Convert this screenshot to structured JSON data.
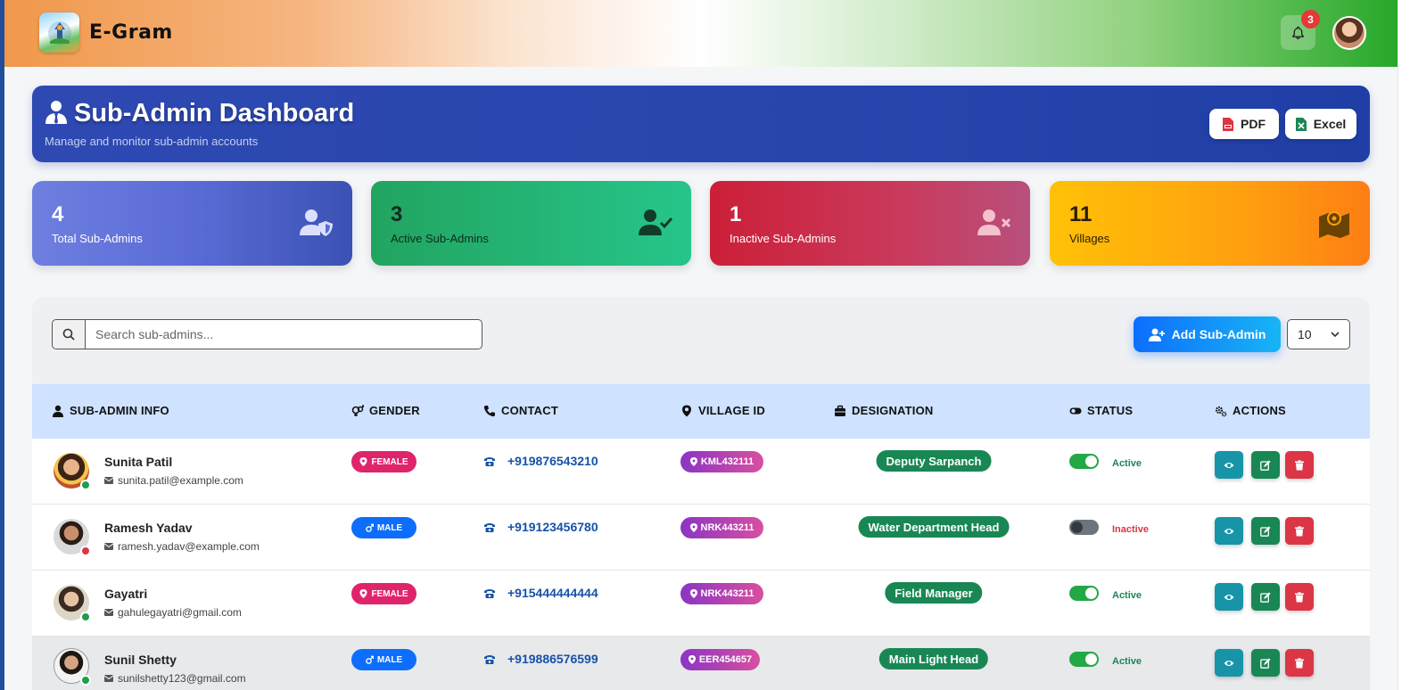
{
  "app": {
    "brand": "E-Gram",
    "notification_count": "3"
  },
  "header": {
    "title": "Sub-Admin Dashboard",
    "subtitle": "Manage and monitor sub-admin accounts",
    "pdf_label": "PDF",
    "excel_label": "Excel"
  },
  "stats": [
    {
      "value": "4",
      "label": "Total Sub-Admins",
      "icon": "user-shield-icon"
    },
    {
      "value": "3",
      "label": "Active Sub-Admins",
      "icon": "user-check-icon"
    },
    {
      "value": "1",
      "label": "Inactive Sub-Admins",
      "icon": "user-times-icon"
    },
    {
      "value": "11",
      "label": "Villages",
      "icon": "map-icon"
    }
  ],
  "toolbar": {
    "search_placeholder": "Search sub-admins...",
    "add_label": "Add Sub-Admin",
    "page_size": "10"
  },
  "table": {
    "columns": [
      "SUB-ADMIN INFO",
      "GENDER",
      "CONTACT",
      "VILLAGE ID",
      "DESIGNATION",
      "STATUS",
      "ACTIONS"
    ],
    "rows": [
      {
        "name": "Sunita Patil",
        "email": "sunita.patil@example.com",
        "gender": "FEMALE",
        "phone": "+919876543210",
        "village": "KML432111",
        "designation": "Deputy Sarpanch",
        "status": "Active"
      },
      {
        "name": "Ramesh Yadav",
        "email": "ramesh.yadav@example.com",
        "gender": "MALE",
        "phone": "+919123456780",
        "village": "NRK443211",
        "designation": "Water Department Head",
        "status": "Inactive"
      },
      {
        "name": "Gayatri",
        "email": "gahulegayatri@gmail.com",
        "gender": "FEMALE",
        "phone": "+915444444444",
        "village": "NRK443211",
        "designation": "Field Manager",
        "status": "Active"
      },
      {
        "name": "Sunil Shetty",
        "email": "sunilshetty123@gmail.com",
        "gender": "MALE",
        "phone": "+919886576599",
        "village": "EER454657",
        "designation": "Main Light Head",
        "status": "Active"
      }
    ]
  },
  "colors": {
    "primary": "#2e49b2",
    "active": "#198754",
    "inactive": "#dc3545",
    "female": "#e0246b",
    "male": "#0d6efd"
  }
}
